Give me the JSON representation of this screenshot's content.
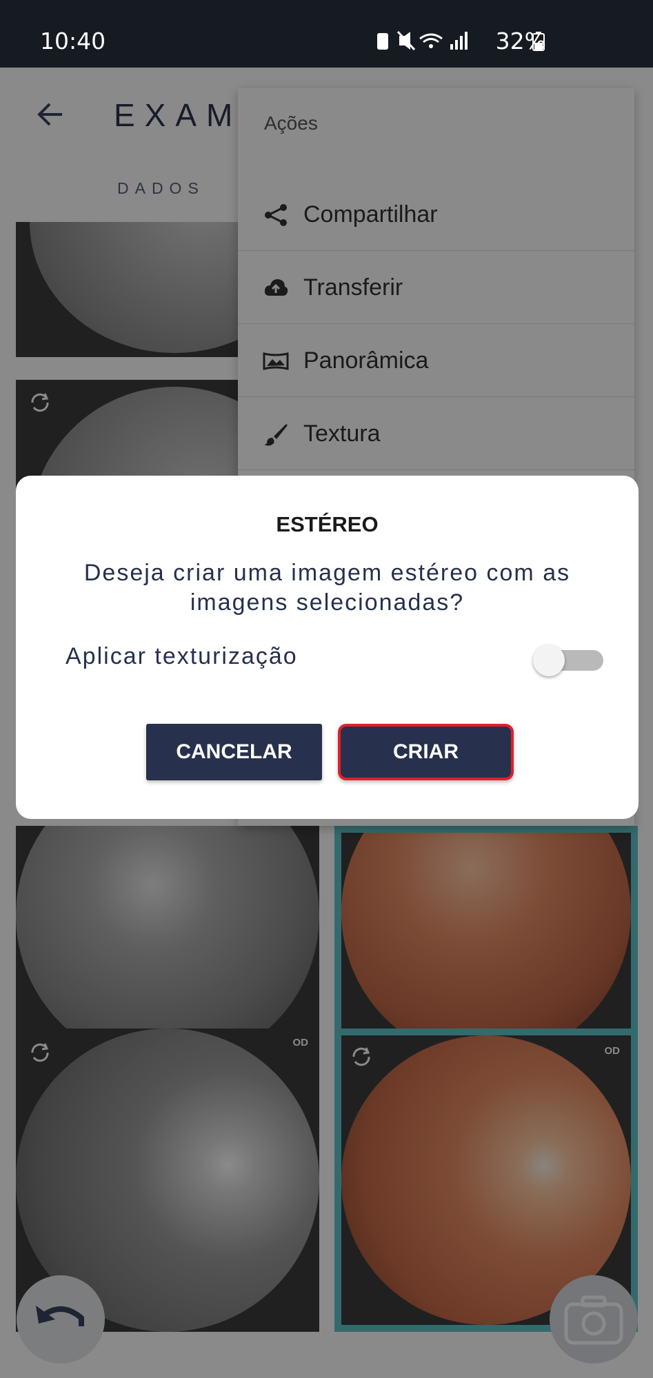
{
  "status_bar": {
    "time": "10:40",
    "battery": "32%"
  },
  "app": {
    "title": "EXAME",
    "tab_dados": "DADOS"
  },
  "thumbnails": [
    {
      "tag": ""
    },
    {
      "tag": ""
    },
    {
      "tag": ""
    },
    {
      "tag": ""
    },
    {
      "tag": "OD"
    },
    {
      "tag": "OD"
    }
  ],
  "menu": {
    "title": "Ações",
    "items": [
      {
        "label": "Compartilhar",
        "icon": "share-icon"
      },
      {
        "label": "Transferir",
        "icon": "cloud-upload-icon"
      },
      {
        "label": "Panorâmica",
        "icon": "panorama-icon"
      },
      {
        "label": "Textura",
        "icon": "brush-icon"
      }
    ]
  },
  "dialog": {
    "title": "ESTÉREO",
    "message": "Deseja criar uma imagem estéreo com as imagens selecionadas?",
    "toggle_label": "Aplicar texturização",
    "toggle_on": false,
    "cancel_label": "CANCELAR",
    "create_label": "CRIAR"
  },
  "colors": {
    "accent_selection": "#5fc4c9",
    "button_bg": "#27314d",
    "highlight": "#e0202a"
  }
}
